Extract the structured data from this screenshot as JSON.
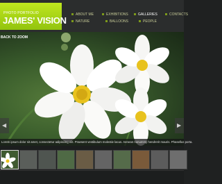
{
  "brand": {
    "subtitle": "PHOTO PORTFOLIO",
    "title": "JAMES' VISION",
    "accent": "#a6d414"
  },
  "nav": [
    {
      "label": "ABOUT ME",
      "active": false
    },
    {
      "label": "EXHIBITIONS",
      "active": false
    },
    {
      "label": "GALLERIES",
      "active": true
    },
    {
      "label": "CONTACTS",
      "active": false
    },
    {
      "label": "NATURE",
      "active": false
    },
    {
      "label": "BALLOONS",
      "active": false
    },
    {
      "label": "PEOPLE",
      "active": false
    }
  ],
  "gallery": {
    "back_label": "BACK TO ZOOM",
    "description": "Lorem ipsum dolor sit amet, consectetur adipiscing elit. Praesent vestibulum molestie lacus. Aenean nonummy hendrerit mauris. Phasellus porta.",
    "prev_icon": "chevron-left-icon",
    "next_icon": "chevron-right-icon"
  },
  "thumbnails": [
    {
      "name": "white-flower",
      "color": "#d8d8d2",
      "active": true
    },
    {
      "name": "grey-1",
      "color": "#5a5e5a",
      "active": false
    },
    {
      "name": "grey-2",
      "color": "#4f5550",
      "active": false
    },
    {
      "name": "green-1",
      "color": "#4f6a45",
      "active": false
    },
    {
      "name": "brown-1",
      "color": "#6a5c45",
      "active": false
    },
    {
      "name": "grey-3",
      "color": "#646464",
      "active": false
    },
    {
      "name": "green-2",
      "color": "#556b4a",
      "active": false
    },
    {
      "name": "brown-2",
      "color": "#7a5a3a",
      "active": false
    },
    {
      "name": "grey-4",
      "color": "#5c5c5c",
      "active": false
    },
    {
      "name": "grey-5",
      "color": "#6e6e6e",
      "active": false
    }
  ]
}
